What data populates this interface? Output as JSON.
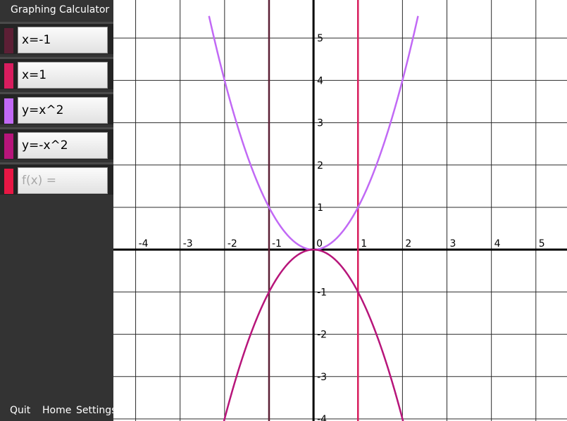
{
  "app": {
    "title": "Graphing Calculator"
  },
  "functions": [
    {
      "expression": "x=-1",
      "placeholder": "",
      "color": "#5c1f35"
    },
    {
      "expression": "x=1",
      "placeholder": "",
      "color": "#d81d5e"
    },
    {
      "expression": "y=x^2",
      "placeholder": "",
      "color": "#c169f5"
    },
    {
      "expression": "y=-x^2",
      "placeholder": "",
      "color": "#b7157a"
    },
    {
      "expression": "",
      "placeholder": "f(x) =",
      "color": "#e81744"
    }
  ],
  "bottom_bar": {
    "quit_label": "Quit",
    "home_label": "Home",
    "settings_label": "Settings"
  },
  "chart_data": {
    "type": "line",
    "xlim": [
      -4.5,
      5.7
    ],
    "ylim": [
      -4.05,
      5.9
    ],
    "grid": true,
    "x_ticks": [
      "-4",
      "-3",
      "-2",
      "-1",
      "0",
      "1",
      "2",
      "3",
      "4",
      "5"
    ],
    "y_ticks": [
      "-4",
      "-3",
      "-2",
      "-1",
      "1",
      "2",
      "3",
      "4",
      "5"
    ],
    "series": [
      {
        "expression": "x=-1",
        "kind": "vertical",
        "x": -1,
        "color": "#5c1f35"
      },
      {
        "expression": "x=1",
        "kind": "vertical",
        "x": 1,
        "color": "#d81d5e"
      },
      {
        "expression": "y=x^2",
        "kind": "function",
        "coefficient": 1,
        "x_range": [
          -2.35,
          2.35
        ],
        "color": "#c169f5"
      },
      {
        "expression": "y=-x^2",
        "kind": "function",
        "coefficient": -1,
        "x_range": [
          -2.05,
          2.05
        ],
        "color": "#b7157a"
      }
    ]
  }
}
